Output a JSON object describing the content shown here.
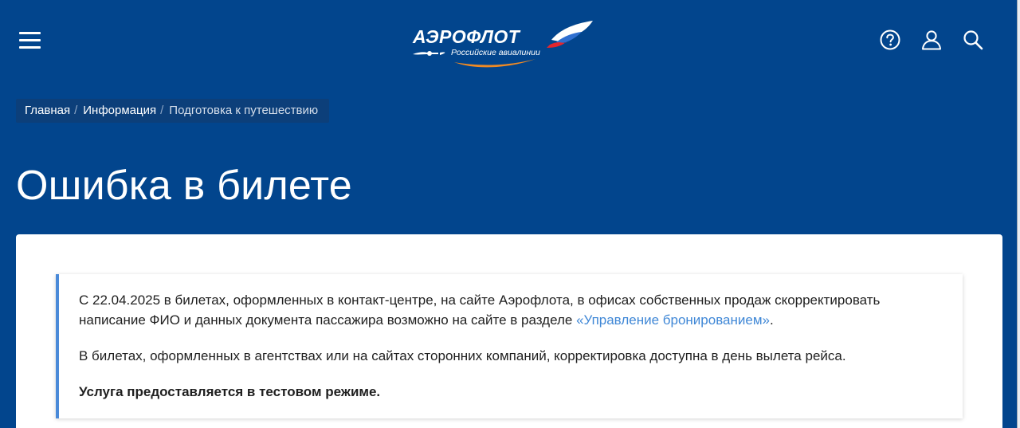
{
  "header": {
    "logo": {
      "wordmark": "АЭРОФЛОТ",
      "tagline": "Российские авиалинии"
    },
    "icons": [
      "menu-icon",
      "help-icon",
      "user-icon",
      "search-icon"
    ]
  },
  "breadcrumb": {
    "items": [
      "Главная",
      "Информация"
    ],
    "separator": "/",
    "current": "Подготовка к путешествию"
  },
  "page": {
    "title": "Ошибка в билете"
  },
  "notice": {
    "p1_text": "С 22.04.2025 в билетах, оформленных в контакт-центре, на сайте Аэрофлота, в офисах собственных продаж скорректировать написание ФИО и данных документа пассажира возможно на сайте в разделе ",
    "p1_link": "«Управление бронированием»",
    "p1_end": ".",
    "p2": "В билетах, оформленных в агентствах или на сайтах сторонних компаний, корректировка доступна в день вылета рейса.",
    "p3": "Услуга предоставляется в тестовом режиме."
  },
  "colors": {
    "background": "#02458d",
    "link": "#3f87d6",
    "notice_border": "#4a8ad9",
    "logo_swoosh": "#f08a24"
  }
}
